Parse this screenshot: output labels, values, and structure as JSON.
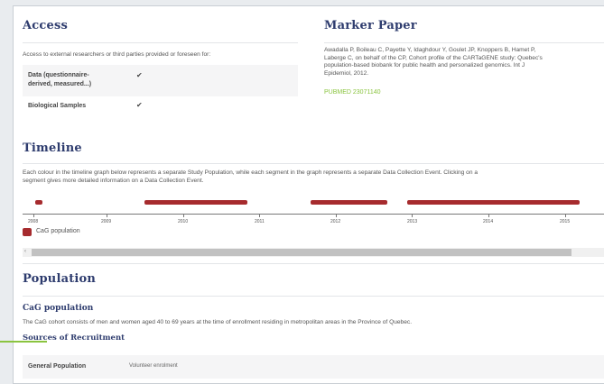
{
  "access": {
    "title": "Access",
    "intro": "Access to external researchers or third parties provided or foreseen for:",
    "rows": [
      {
        "label_line1": "Data (questionnaire-",
        "label_line2": "derived, measured...)",
        "check": "✔"
      },
      {
        "label": "Biological Samples",
        "check": "✔"
      }
    ]
  },
  "marker_paper": {
    "title": "Marker Paper",
    "lines": [
      "Awadalla P, Boileau C, Payette Y, Idaghdour Y, Goulet JP, Knoppers B, Hamet P,",
      "Laberge C, on behalf of the CP, Cohort profile of the CARTaGENE study: Quebec's",
      "population-based biobank for public health and personalized genomics. Int J",
      "Epidemiol, 2012."
    ],
    "pubmed": "PUBMED 23071140"
  },
  "timeline": {
    "title": "Timeline",
    "description_line1": "Each colour in the timeline graph below represents a separate Study Population, while each segment in the graph represents a separate Data Collection Event. Clicking on a",
    "description_line2": "segment gives more detailed information on a Data Collection Event.",
    "years": [
      "2008",
      "2009",
      "2010",
      "2011",
      "2012",
      "2013",
      "2014",
      "2015"
    ],
    "legend": "CaG population",
    "color": "#a62b2e"
  },
  "population": {
    "title": "Population",
    "subtitle": "CaG population",
    "description": "The CaG cohort consists of men and women aged 40 to 69 years at the time of enrollment residing in metropolitan areas in the Province of Quebec.",
    "recruitment_title": "Sources of Recruitment",
    "row_label": "General Population",
    "row_value": "Volunteer enrolment"
  },
  "colors": {
    "heading": "#2e3c6e",
    "accent_green": "#8ac43f",
    "timeline_bar": "#a62b2e"
  }
}
